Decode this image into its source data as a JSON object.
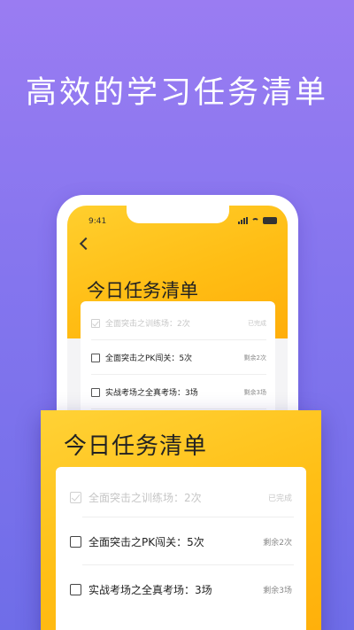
{
  "headline": "高效的学习任务清单",
  "phone": {
    "time": "9:41",
    "title": "今日任务清单",
    "tasks": [
      {
        "label": "全面突击之训练场：2次",
        "status": "已完成",
        "done": true
      },
      {
        "label": "全面突击之PK闯关：5次",
        "status": "剩余2次",
        "done": false
      },
      {
        "label": "实战考场之全真考场：3场",
        "status": "剩余3场",
        "done": false
      }
    ]
  },
  "zoom": {
    "title": "今日任务清单",
    "tasks": [
      {
        "label": "全面突击之训练场：2次",
        "status": "已完成",
        "done": true
      },
      {
        "label": "全面突击之PK闯关：5次",
        "status": "剩余2次",
        "done": false
      },
      {
        "label": "实战考场之全真考场：3场",
        "status": "剩余3场",
        "done": false
      }
    ]
  },
  "colors": {
    "background_top": "#9a7cf2",
    "background_bottom": "#6f6de8",
    "accent_yellow": "#ffbf16"
  }
}
